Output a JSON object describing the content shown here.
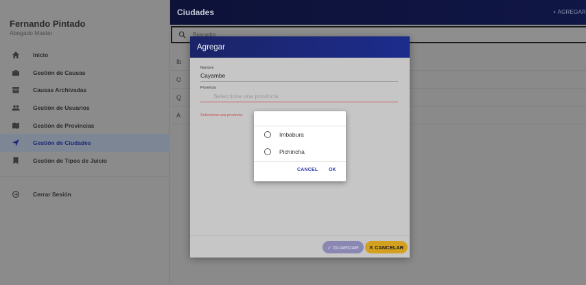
{
  "user": {
    "name": "Fernando Pintado",
    "role": "Abogado Master"
  },
  "sidebar": {
    "items": [
      {
        "label": "Inicio",
        "icon": "home-icon"
      },
      {
        "label": "Gestión de Causas",
        "icon": "briefcase-icon"
      },
      {
        "label": "Causas Archivadas",
        "icon": "archive-icon"
      },
      {
        "label": "Gestión de Usuarios",
        "icon": "users-icon"
      },
      {
        "label": "Gestión de Provincias",
        "icon": "map-icon"
      },
      {
        "label": "Gestión de Ciudades",
        "icon": "location-arrow-icon",
        "active": true
      },
      {
        "label": "Gestión de Tipos de Juicio",
        "icon": "bookmark-icon"
      }
    ],
    "logout": {
      "label": "Cerrar Sesión",
      "icon": "logout-icon"
    }
  },
  "header": {
    "title": "Ciudades",
    "add_label": "+ AGREGAR"
  },
  "search": {
    "placeholder": "Buscador"
  },
  "list": {
    "rows": [
      "Ib",
      "O",
      "Q",
      "A"
    ]
  },
  "dialog": {
    "title": "Agregar",
    "nombre": {
      "label": "Nombre",
      "value": "Cayambe"
    },
    "provincia": {
      "label": "Provincia",
      "placeholder": "Seleccione una provincia"
    },
    "error": "Seleccione una provincia",
    "save_label": "GUARDAR",
    "cancel_label": "CANCELAR"
  },
  "select": {
    "options": [
      "Imbabura",
      "Pichincha"
    ],
    "cancel_label": "CANCEL",
    "ok_label": "OK"
  },
  "colors": {
    "primary": "#1c2c8c",
    "accent": "#e6ad22",
    "error": "#c64848"
  }
}
